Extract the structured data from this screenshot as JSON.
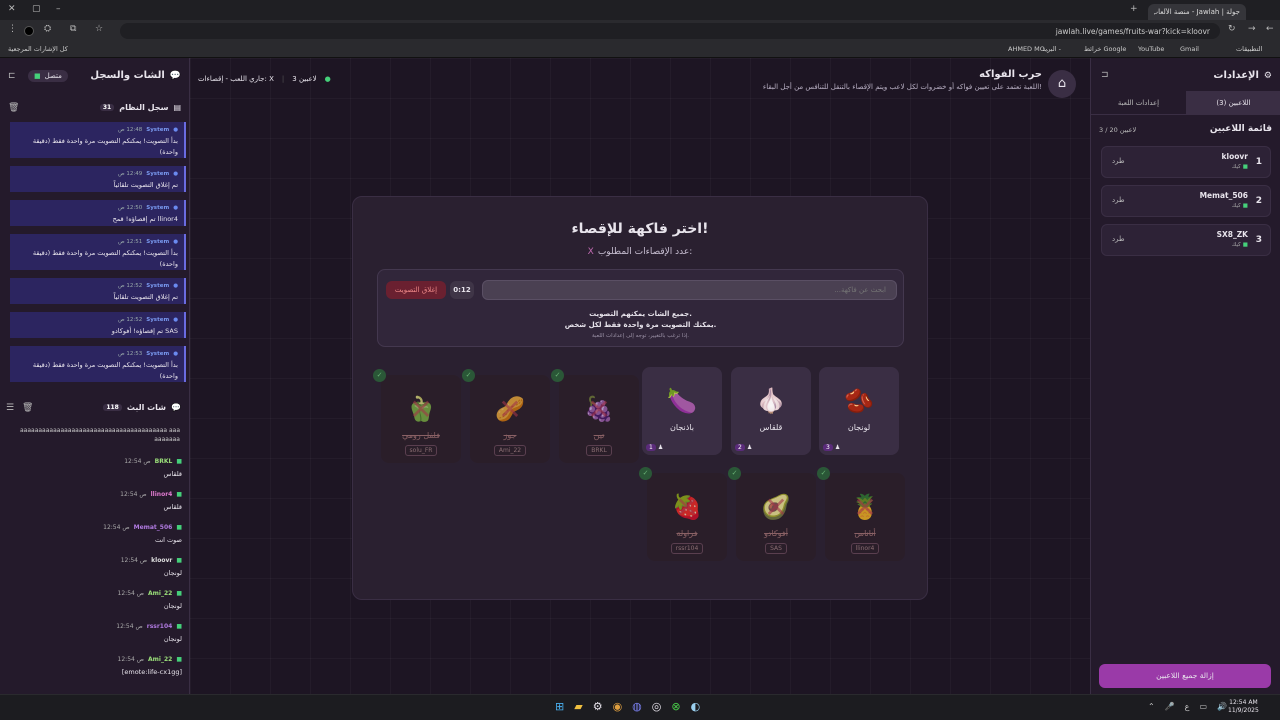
{
  "browser": {
    "tab_title": "جولة | Jawlah - منصة الألعاب الت...",
    "url": "jawlah.live/games/fruits-war?kick=kloovr",
    "bookmarks": [
      "التطبيقات",
      "Gmail",
      "YouTube",
      "خرائط Google",
      "البريد -",
      "AHMED MO...",
      "كل الإشارات المرجعية"
    ]
  },
  "settings": {
    "title": "الإعدادات",
    "tabs": [
      "اللاعبين (3)",
      "إعدادات اللعبة"
    ],
    "list_title": "قائمة اللاعبين",
    "count": "3 / 20 لاعبين",
    "kick_label": "طرد",
    "platform_label": "كيك",
    "players": [
      {
        "rank": "1",
        "name": "kloovr"
      },
      {
        "rank": "2",
        "name": "Memat_506"
      },
      {
        "rank": "3",
        "name": "SX8_ZK"
      }
    ],
    "remove_all": "إزالة جميع اللاعبين"
  },
  "header": {
    "title": "حرب الفواكه",
    "desc": "اللعبة تعتمد على تعيين فواكه أو خضروات لكل لاعب ويتم الإقصاء بالتنقل للتنافس من أجل البقاء!",
    "status_players": "3 لاعبين",
    "status_state": "جاري اللعب - إقصاءات: X"
  },
  "vote": {
    "title": "اختر فاكهة للإقصاء!",
    "required": "عدد الإقصاءات المطلوب:",
    "required_value": "X",
    "search_placeholder": "ابحث عن فاكهة...",
    "timer": "0:12",
    "close_vote": "إغلاق التصويت",
    "info1": "جميع الشات يمكنهم التصويت.",
    "info2": "يمكنك التصويت مرة واحدة فقط لكل شخص.",
    "info3": "إذا ترغب بالتغيير، توجه إلى إعدادات اللعبة."
  },
  "fruits_active": [
    {
      "name": "لونجان",
      "icon": "🫘",
      "count": "3"
    },
    {
      "name": "قلقاس",
      "icon": "🧄",
      "count": "2"
    },
    {
      "name": "باذنجان",
      "icon": "🍆",
      "count": "1"
    }
  ],
  "fruits_out_row1": [
    {
      "name": "تين",
      "icon": "🍇",
      "player": "BRKL"
    },
    {
      "name": "جوز",
      "icon": "🥜",
      "player": "Ami_22"
    },
    {
      "name": "فلفل رومي",
      "icon": "🫑",
      "player": "solu_FR"
    }
  ],
  "fruits_out_row2": [
    {
      "name": "أناناس",
      "icon": "🍍",
      "player": "llinor4"
    },
    {
      "name": "أفوكادو",
      "icon": "🥑",
      "player": "SAS"
    },
    {
      "name": "فراولة",
      "icon": "🍓",
      "player": "rssr104"
    }
  ],
  "left": {
    "title": "الشات والسجل",
    "connected": "متصل",
    "syslog_title": "سجل النظام",
    "syslog_count": "31",
    "system_name": "System",
    "syslog": [
      {
        "time": "12:48 ص",
        "text": "بدأ التصويت! يمكنكم التصويت مرة واحدة فقط (دقيقة واحدة)"
      },
      {
        "time": "12:49 ص",
        "text": "تم إغلاق التصويت تلقائياً"
      },
      {
        "time": "12:50 ص",
        "text": "llinor4 تم إقصاؤه! قمح"
      },
      {
        "time": "12:51 ص",
        "text": "بدأ التصويت! يمكنكم التصويت مرة واحدة فقط (دقيقة واحدة)"
      },
      {
        "time": "12:52 ص",
        "text": "تم إغلاق التصويت تلقائياً"
      },
      {
        "time": "12:52 ص",
        "text": "SAS تم إقصاؤه! أفوكادو"
      },
      {
        "time": "12:53 ص",
        "text": "بدأ التصويت! يمكنكم التصويت مرة واحدة فقط (دقيقة واحدة)"
      }
    ],
    "chat_title": "شات البث",
    "chat_count": "118",
    "chat_top": "aaaaaaaaaaaaaaaaaaaaaaaaaaaaaaaaaaaaaaaa aaaaaaaaaa",
    "chat": [
      {
        "user": "BRKL",
        "time": "12:54 ص",
        "text": "قلقاس",
        "color": "#9be07a"
      },
      {
        "user": "llinor4",
        "time": "12:54 ص",
        "text": "قلقاس",
        "color": "#e07ad0"
      },
      {
        "user": "Memat_506",
        "time": "12:54 ص",
        "text": "صوت انت",
        "color": "#b07ae0"
      },
      {
        "user": "kloovr",
        "time": "12:54 ص",
        "text": "لونجان",
        "color": "#e0e0e0"
      },
      {
        "user": "Ami_22",
        "time": "12:54 ص",
        "text": "لونجان",
        "color": "#9be07a"
      },
      {
        "user": "rssr104",
        "time": "12:54 ص",
        "text": "لونجان",
        "color": "#b07ae0"
      },
      {
        "user": "Ami_22",
        "time": "12:54 ص",
        "text": "[emote:life-cx1gg]",
        "color": "#9be07a"
      }
    ]
  },
  "taskbar": {
    "time": "12:54 AM",
    "date": "11/9/2025",
    "lang": "ع"
  }
}
